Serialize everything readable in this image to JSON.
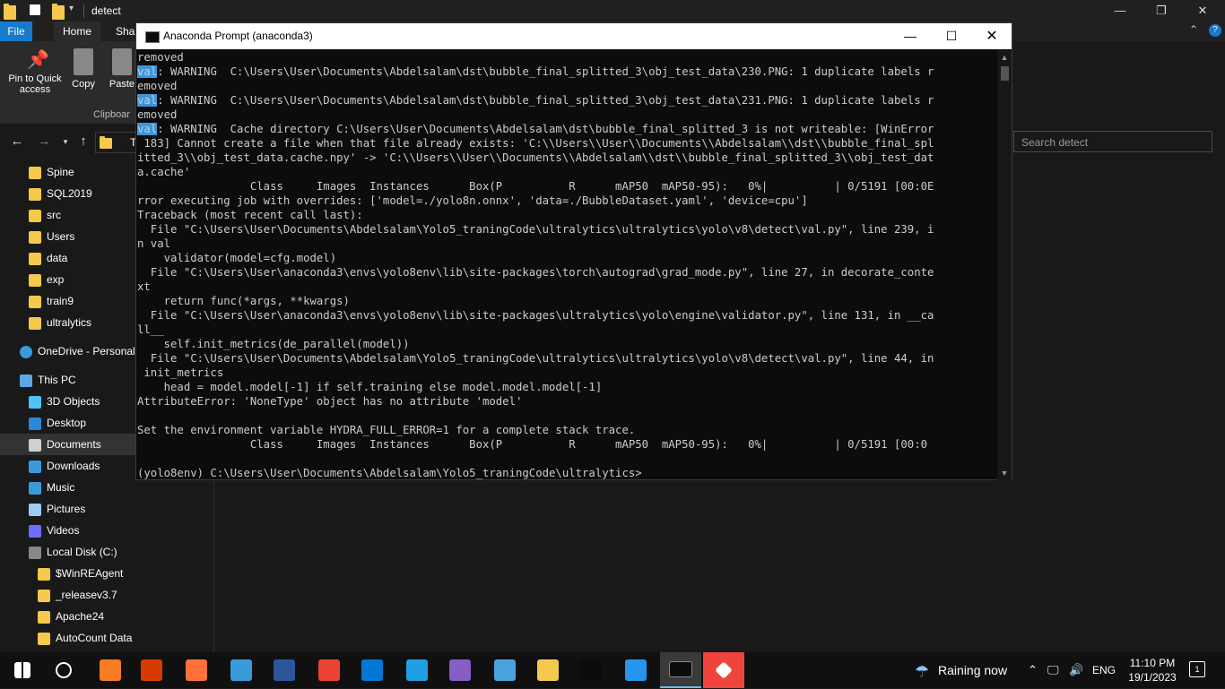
{
  "explorer": {
    "title": "detect",
    "tabs": {
      "file": "File",
      "home": "Home",
      "share": "Shar"
    },
    "ribbon": {
      "pin": "Pin to Quick access",
      "copy": "Copy",
      "paste": "Paste",
      "group": "Clipboar"
    },
    "address_fragment": "T",
    "search_placeholder": "Search detect",
    "nav": [
      {
        "label": "Spine",
        "icon": "folder-icon"
      },
      {
        "label": "SQL2019",
        "icon": "folder-icon"
      },
      {
        "label": "src",
        "icon": "folder-icon"
      },
      {
        "label": "Users",
        "icon": "folder-icon"
      },
      {
        "label": "data",
        "icon": "folder-icon"
      },
      {
        "label": "exp",
        "icon": "folder-icon"
      },
      {
        "label": "train9",
        "icon": "folder-icon"
      },
      {
        "label": "ultralytics",
        "icon": "folder-icon"
      },
      {
        "label": "OneDrive - Personal",
        "icon": "cloud-icon"
      },
      {
        "label": "This PC",
        "icon": "computer-icon"
      },
      {
        "label": "3D Objects",
        "icon": "cube-icon"
      },
      {
        "label": "Desktop",
        "icon": "desktop-icon"
      },
      {
        "label": "Documents",
        "icon": "document-icon",
        "selected": true
      },
      {
        "label": "Downloads",
        "icon": "download-icon"
      },
      {
        "label": "Music",
        "icon": "music-icon"
      },
      {
        "label": "Pictures",
        "icon": "picture-icon"
      },
      {
        "label": "Videos",
        "icon": "video-icon"
      },
      {
        "label": "Local Disk (C:)",
        "icon": "disk-icon"
      },
      {
        "label": "$WinREAgent",
        "icon": "folder-icon"
      },
      {
        "label": "_releasev3.7",
        "icon": "folder-icon"
      },
      {
        "label": "Apache24",
        "icon": "folder-icon"
      },
      {
        "label": "AutoCount Data",
        "icon": "folder-icon"
      }
    ]
  },
  "terminal": {
    "title": "Anaconda Prompt (anaconda3)",
    "lines": [
      "removed",
      "val: WARNING  C:\\Users\\User\\Documents\\Abdelsalam\\dst\\bubble_final_splitted_3\\obj_test_data\\230.PNG: 1 duplicate labels r",
      "emoved",
      "val: WARNING  C:\\Users\\User\\Documents\\Abdelsalam\\dst\\bubble_final_splitted_3\\obj_test_data\\231.PNG: 1 duplicate labels r",
      "emoved",
      "val: WARNING  Cache directory C:\\Users\\User\\Documents\\Abdelsalam\\dst\\bubble_final_splitted_3 is not writeable: [WinError",
      " 183] Cannot create a file when that file already exists: 'C:\\\\Users\\\\User\\\\Documents\\\\Abdelsalam\\\\dst\\\\bubble_final_spl",
      "itted_3\\\\obj_test_data.cache.npy' -> 'C:\\\\Users\\\\User\\\\Documents\\\\Abdelsalam\\\\dst\\\\bubble_final_splitted_3\\\\obj_test_dat",
      "a.cache'",
      "                 Class     Images  Instances      Box(P          R      mAP50  mAP50-95):   0%|          | 0/5191 [00:0E",
      "rror executing job with overrides: ['model=./yolo8n.onnx', 'data=./BubbleDataset.yaml', 'device=cpu']",
      "Traceback (most recent call last):",
      "  File \"C:\\Users\\User\\Documents\\Abdelsalam\\Yolo5_traningCode\\ultralytics\\ultralytics\\yolo\\v8\\detect\\val.py\", line 239, i",
      "n val",
      "    validator(model=cfg.model)",
      "  File \"C:\\Users\\User\\anaconda3\\envs\\yolo8env\\lib\\site-packages\\torch\\autograd\\grad_mode.py\", line 27, in decorate_conte",
      "xt",
      "    return func(*args, **kwargs)",
      "  File \"C:\\Users\\User\\anaconda3\\envs\\yolo8env\\lib\\site-packages\\ultralytics\\yolo\\engine\\validator.py\", line 131, in __ca",
      "ll__",
      "    self.init_metrics(de_parallel(model))",
      "  File \"C:\\Users\\User\\Documents\\Abdelsalam\\Yolo5_traningCode\\ultralytics\\ultralytics\\yolo\\v8\\detect\\val.py\", line 44, in",
      " init_metrics",
      "    head = model.model[-1] if self.training else model.model.model[-1]",
      "AttributeError: 'NoneType' object has no attribute 'model'",
      "",
      "Set the environment variable HYDRA_FULL_ERROR=1 for a complete stack trace.",
      "                 Class     Images  Instances      Box(P          R      mAP50  mAP50-95):   0%|          | 0/5191 [00:0",
      "",
      "(yolo8env) C:\\Users\\User\\Documents\\Abdelsalam\\Yolo5_traningCode\\ultralytics>"
    ]
  },
  "taskbar": {
    "apps": [
      "start-button",
      "search-button",
      "xampp-app",
      "office-app",
      "firefox-app",
      "control-panel-app",
      "word-app",
      "chrome-app",
      "vscode-app",
      "edge-app",
      "visual-studio-app",
      "network-app",
      "file-explorer-app",
      "terminal-app",
      "docker-app",
      "anaconda-prompt-app",
      "anydesk-app"
    ],
    "weather": "Raining now",
    "language": "ENG",
    "time": "11:10 PM",
    "date": "19/1/2023",
    "notifications": "1"
  }
}
